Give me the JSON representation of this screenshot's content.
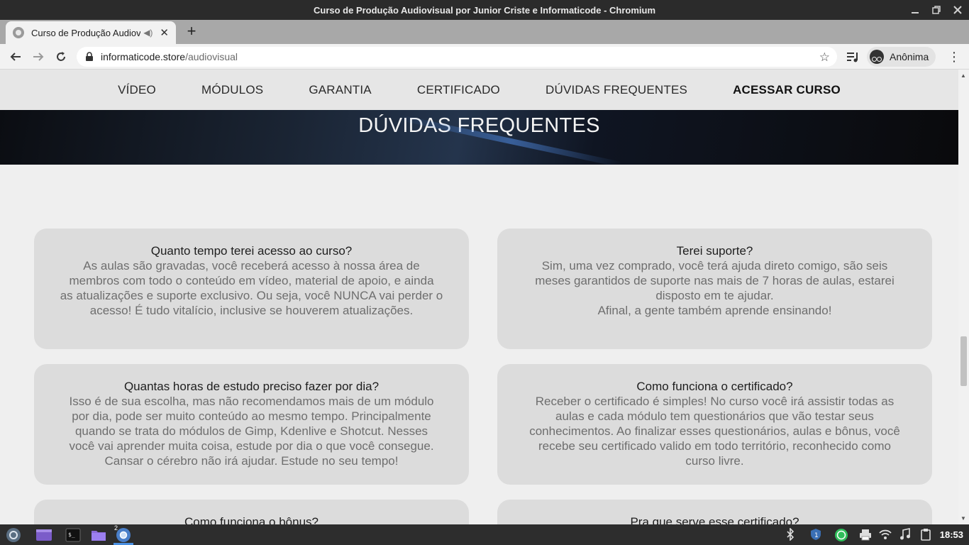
{
  "window": {
    "title": "Curso de Produção Audiovisual por Junior Criste e Informaticode - Chromium"
  },
  "tab": {
    "title": "Curso de Produção Audiov",
    "new_tab_label": "+"
  },
  "omnibox": {
    "host": "informaticode.store",
    "path": "/audiovisual"
  },
  "profile": {
    "label": "Anônima"
  },
  "site_nav": {
    "items": [
      {
        "label": "VÍDEO"
      },
      {
        "label": "MÓDULOS"
      },
      {
        "label": "GARANTIA"
      },
      {
        "label": "CERTIFICADO"
      },
      {
        "label": "DÚVIDAS FREQUENTES"
      },
      {
        "label": "ACESSAR CURSO"
      }
    ]
  },
  "hero": {
    "title": "DÚVIDAS FREQUENTES"
  },
  "faq": [
    {
      "question": "Quanto tempo terei acesso ao curso?",
      "answer": [
        "As aulas são gravadas, você receberá acesso à nossa área de",
        "membros com todo o conteúdo em vídeo, material de apoio, e ainda",
        "as atualizações e suporte exclusivo. Ou seja, você NUNCA vai perder o",
        "acesso! É tudo vitalício, inclusive se houverem atualizações."
      ]
    },
    {
      "question": "Terei suporte?",
      "answer": [
        "Sim, uma vez comprado, você terá ajuda direto comigo, são seis",
        "meses garantidos de suporte nas mais de 7 horas de aulas, estarei",
        "disposto em te ajudar.",
        "Afinal, a gente também aprende ensinando!"
      ]
    },
    {
      "question": "Quantas horas de estudo preciso fazer por dia?",
      "answer": [
        "Isso é de sua escolha, mas não recomendamos mais de um módulo",
        "por dia, pode ser muito conteúdo ao mesmo tempo. Principalmente",
        "quando se trata do módulos de Gimp, Kdenlive e Shotcut. Nesses",
        "você vai aprender muita coisa, estude por dia o que você consegue.",
        "Cansar o cérebro não irá ajudar. Estude no seu tempo!"
      ]
    },
    {
      "question": "Como funciona o certificado?",
      "answer": [
        "Receber o certificado é simples! No curso você irá assistir todas as",
        "aulas e cada módulo tem questionários que vão testar seus",
        "conhecimentos. Ao finalizar esses questionários, aulas e bônus, você",
        "recebe seu certificado valido em todo território, reconhecido como",
        "curso livre."
      ]
    },
    {
      "question": "Como funciona o bônus?",
      "answer": []
    },
    {
      "question": "Pra que serve esse certificado?",
      "answer": []
    }
  ],
  "taskbar": {
    "chromium_badge": "2",
    "clock": "18:53"
  },
  "colors": {
    "page_bg": "#efefef",
    "card_bg": "#dcdcdc",
    "nav_bg": "#e6e6e6",
    "titlebar_bg": "#2b2b2b",
    "taskbar_bg": "#2d2d2d"
  }
}
